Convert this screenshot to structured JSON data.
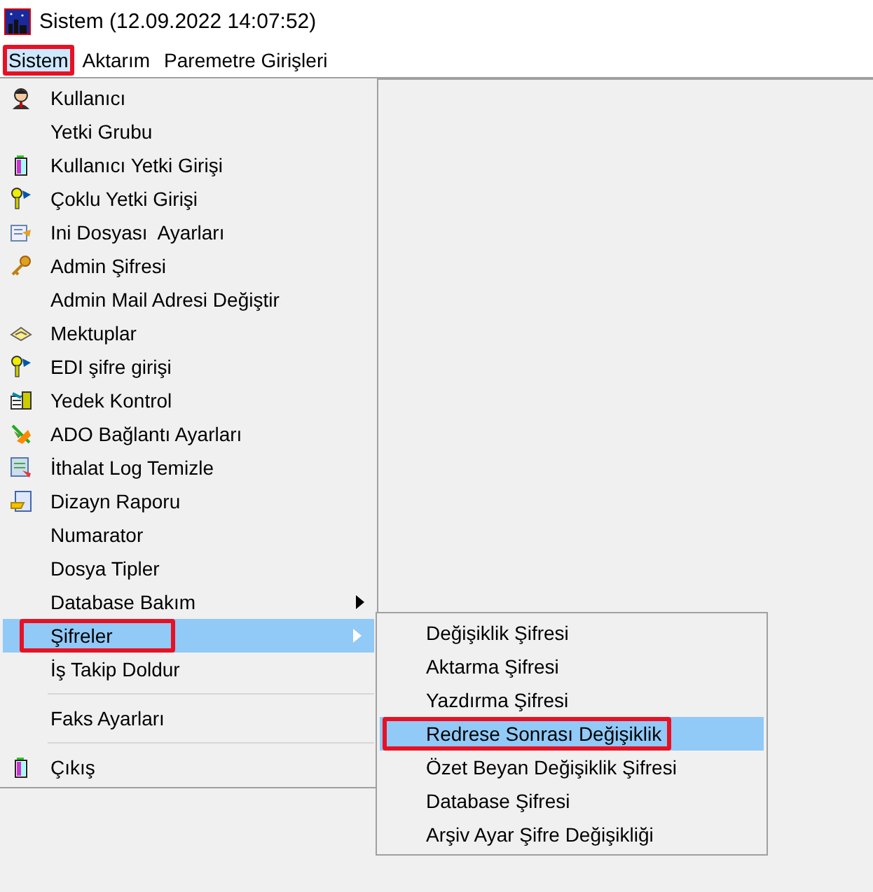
{
  "window": {
    "title": "Sistem (12.09.2022 14:07:52)"
  },
  "menu_bar": [
    {
      "label": "Sistem",
      "selected": true,
      "marked": true
    },
    {
      "label": "Aktarım",
      "selected": false,
      "marked": false
    },
    {
      "label": "Paremetre Girişleri",
      "selected": false,
      "marked": false
    }
  ],
  "menu": [
    {
      "kind": "item",
      "label": "Kullanıcı",
      "has_icon": true,
      "highlighted": false,
      "submenu": false,
      "marked": false
    },
    {
      "kind": "item",
      "label": "Yetki Grubu",
      "has_icon": false,
      "highlighted": false,
      "submenu": false,
      "marked": false
    },
    {
      "kind": "item",
      "label": "Kullanıcı Yetki Girişi",
      "has_icon": true,
      "highlighted": false,
      "submenu": false,
      "marked": false
    },
    {
      "kind": "item",
      "label": "Çoklu Yetki Girişi",
      "has_icon": true,
      "highlighted": false,
      "submenu": false,
      "marked": false
    },
    {
      "kind": "item",
      "label": "Ini Dosyası  Ayarları",
      "has_icon": true,
      "highlighted": false,
      "submenu": false,
      "marked": false
    },
    {
      "kind": "item",
      "label": "Admin Şifresi",
      "has_icon": true,
      "highlighted": false,
      "submenu": false,
      "marked": false
    },
    {
      "kind": "item",
      "label": "Admin Mail Adresi Değiştir",
      "has_icon": false,
      "highlighted": false,
      "submenu": false,
      "marked": false
    },
    {
      "kind": "item",
      "label": "Mektuplar",
      "has_icon": true,
      "highlighted": false,
      "submenu": false,
      "marked": false
    },
    {
      "kind": "item",
      "label": "EDI şifre girişi",
      "has_icon": true,
      "highlighted": false,
      "submenu": false,
      "marked": false
    },
    {
      "kind": "item",
      "label": "Yedek Kontrol",
      "has_icon": true,
      "highlighted": false,
      "submenu": false,
      "marked": false
    },
    {
      "kind": "item",
      "label": "ADO Bağlantı Ayarları",
      "has_icon": true,
      "highlighted": false,
      "submenu": false,
      "marked": false
    },
    {
      "kind": "item",
      "label": "İthalat Log Temizle",
      "has_icon": true,
      "highlighted": false,
      "submenu": false,
      "marked": false
    },
    {
      "kind": "item",
      "label": "Dizayn Raporu",
      "has_icon": true,
      "highlighted": false,
      "submenu": false,
      "marked": false
    },
    {
      "kind": "item",
      "label": "Numarator",
      "has_icon": false,
      "highlighted": false,
      "submenu": false,
      "marked": false
    },
    {
      "kind": "item",
      "label": "Dosya Tipler",
      "has_icon": false,
      "highlighted": false,
      "submenu": false,
      "marked": false
    },
    {
      "kind": "item",
      "label": "Database Bakım",
      "has_icon": false,
      "highlighted": false,
      "submenu": true,
      "marked": false
    },
    {
      "kind": "item",
      "label": "Şifreler",
      "has_icon": false,
      "highlighted": true,
      "submenu": true,
      "marked": true
    },
    {
      "kind": "item",
      "label": "İş Takip Doldur",
      "has_icon": false,
      "highlighted": false,
      "submenu": false,
      "marked": false
    },
    {
      "kind": "separator"
    },
    {
      "kind": "item",
      "label": "Faks Ayarları",
      "has_icon": false,
      "highlighted": false,
      "submenu": false,
      "marked": false
    },
    {
      "kind": "separator"
    },
    {
      "kind": "item",
      "label": "Çıkış",
      "has_icon": true,
      "highlighted": false,
      "submenu": false,
      "marked": false
    }
  ],
  "submenu": [
    {
      "label": "Değişiklik Şifresi",
      "highlighted": false,
      "marked": false
    },
    {
      "label": "Aktarma Şifresi",
      "highlighted": false,
      "marked": false
    },
    {
      "label": "Yazdırma Şifresi",
      "highlighted": false,
      "marked": false
    },
    {
      "label": "Redrese Sonrası Değişiklik",
      "highlighted": true,
      "marked": true
    },
    {
      "label": "Özet Beyan Değişiklik Şifresi",
      "highlighted": false,
      "marked": false
    },
    {
      "label": "Database Şifresi",
      "highlighted": false,
      "marked": false
    },
    {
      "label": "Arşiv Ayar Şifre Değişikliği",
      "highlighted": false,
      "marked": false
    }
  ]
}
